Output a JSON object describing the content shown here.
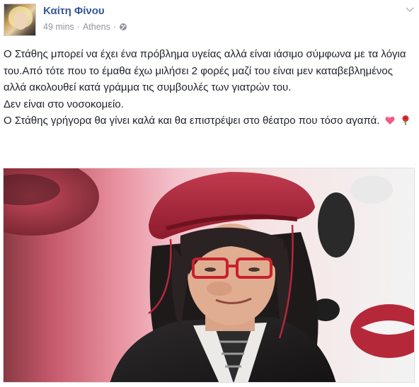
{
  "post": {
    "author": "Καίτη Φίνου",
    "time": "49 mins",
    "separator": "·",
    "location": "Athens",
    "lines": [
      "Ο Στάθης μπορεί να έχει ένα πρόβλημα υγείας αλλά είναι ιάσιμο σύμφωνα με τα λόγια του.Από τότε που το έμαθα έχω μιλήσει 2 φορές μαζί του είναι μεν καταβεβλημένος αλλά ακολουθεί κατά γράμμα τις συμβουλές των γιατρών του.",
      "Δεν είναι στο νοσοκομείο.",
      "Ο Στάθης γρήγορα θα γίνει καλά και θα επιστρέψει στο θέατρο που τόσο αγαπά."
    ],
    "emojis": [
      "heart-emoji",
      "rose-emoji"
    ]
  },
  "icons": {
    "globe": "globe-icon",
    "chevron": "chevron-down-icon"
  },
  "colors": {
    "author": "#365899",
    "meta": "#90949c",
    "text": "#1d2129",
    "beret": "#a31f34"
  }
}
